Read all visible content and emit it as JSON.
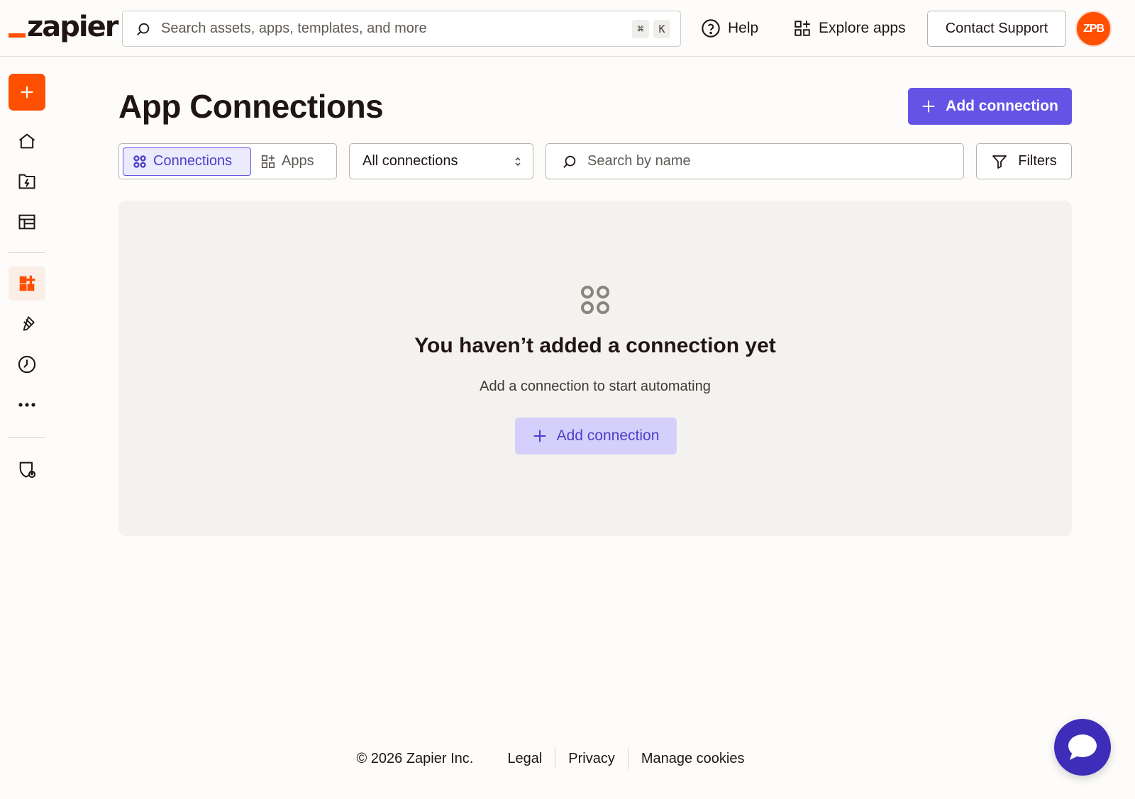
{
  "brand": {
    "logo_text": "zapier",
    "accent": "#ff4f00",
    "primary": "#6454e6"
  },
  "header": {
    "search_placeholder": "Search assets, apps, templates, and more",
    "shortcut_keys": [
      "⌘",
      "K"
    ],
    "help_label": "Help",
    "explore_label": "Explore apps",
    "contact_label": "Contact Support",
    "avatar_initials": "ZPB"
  },
  "sidebar": {
    "items": [
      {
        "icon": "plus-icon",
        "label": "Create"
      },
      {
        "icon": "home-icon"
      },
      {
        "icon": "zap-folder-icon"
      },
      {
        "icon": "table-icon"
      },
      {
        "icon": "app-grid-icon",
        "active": true
      },
      {
        "icon": "brush-icon"
      },
      {
        "icon": "history-icon"
      },
      {
        "icon": "more-icon"
      },
      {
        "icon": "admin-shield-icon"
      }
    ]
  },
  "main": {
    "title": "App Connections",
    "add_button": "Add connection",
    "tabs": [
      {
        "label": "Connections",
        "active": true
      },
      {
        "label": "Apps",
        "active": false
      }
    ],
    "select_value": "All connections",
    "search_placeholder": "Search by name",
    "filters_label": "Filters",
    "empty": {
      "title": "You haven’t added a connection yet",
      "subtitle": "Add a connection to start automating",
      "button": "Add connection"
    }
  },
  "footer": {
    "copyright": "© 2026 Zapier Inc.",
    "links": [
      "Legal",
      "Privacy",
      "Manage cookies"
    ]
  }
}
